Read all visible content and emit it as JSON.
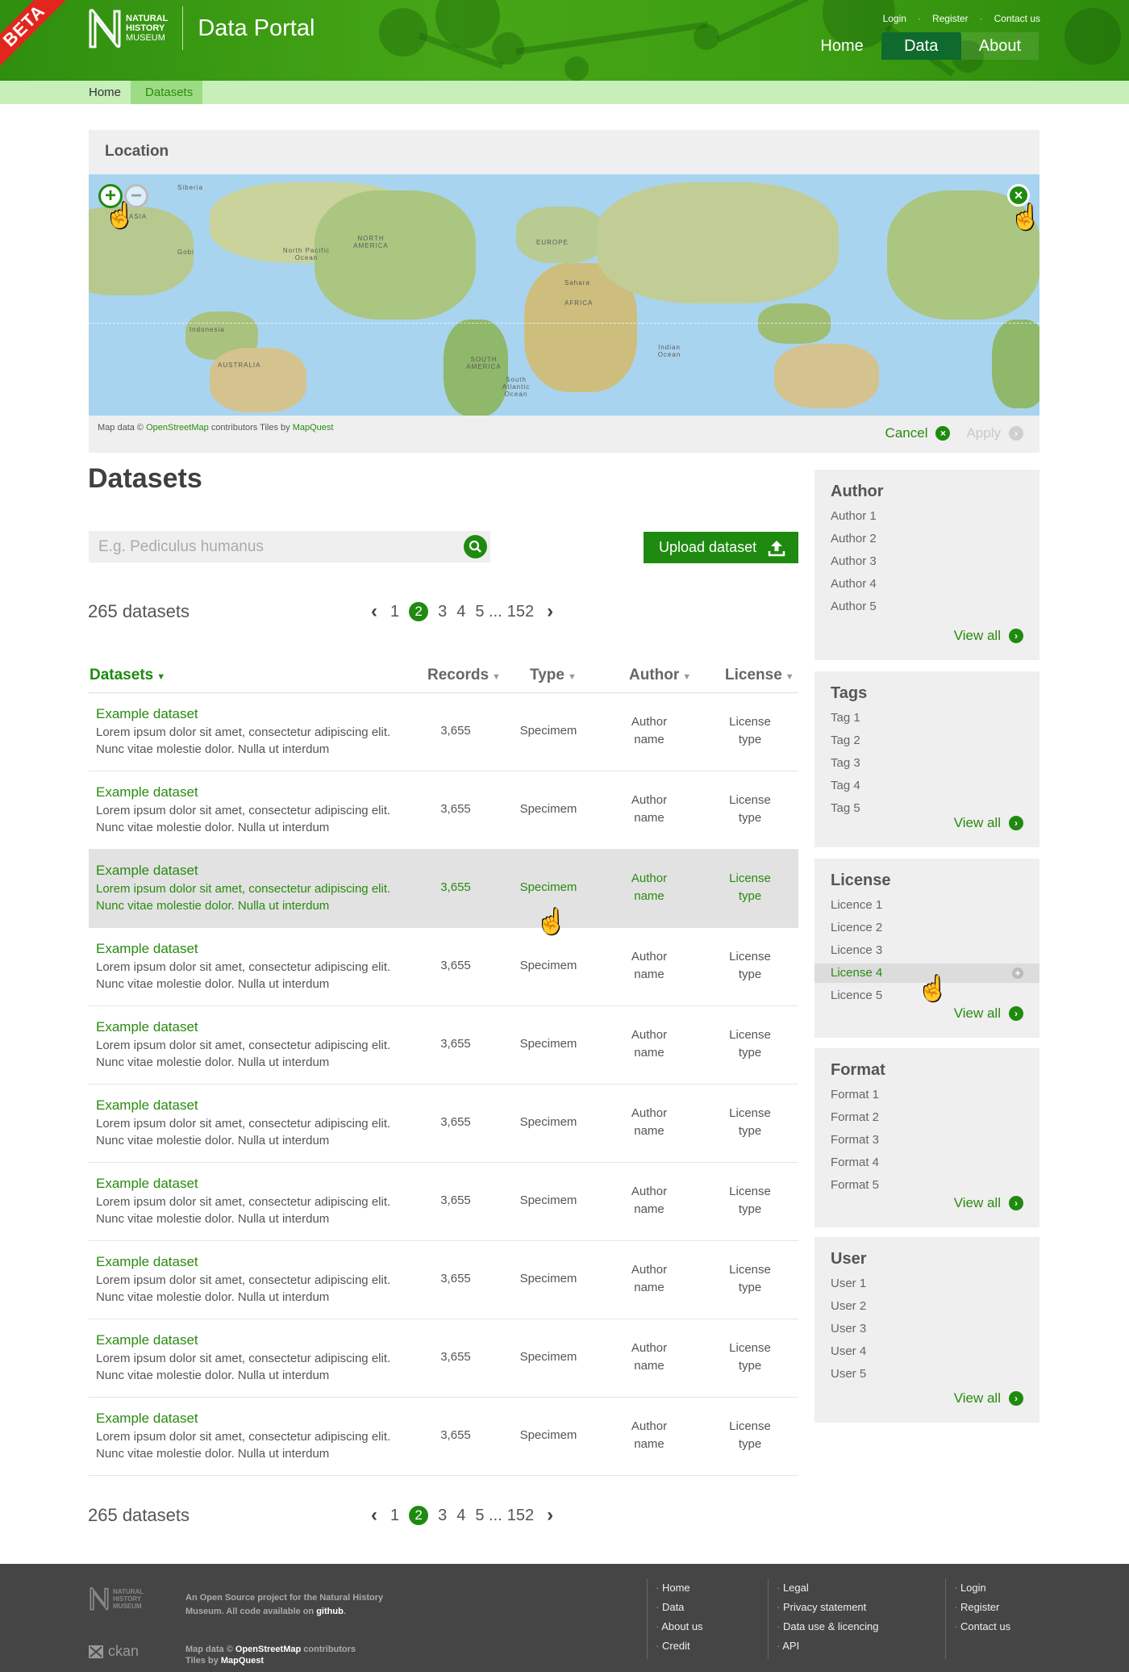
{
  "header": {
    "beta": "BETA",
    "logo_lines": [
      "NATURAL",
      "HISTORY",
      "MUSEUM"
    ],
    "portal_title": "Data Portal",
    "top_links": [
      "Login",
      "Register",
      "Contact us"
    ],
    "nav": [
      "Home",
      "Data",
      "About"
    ],
    "active_nav": "Data"
  },
  "breadcrumb": {
    "home": "Home",
    "current": "Datasets"
  },
  "location": {
    "title": "Location",
    "map_labels": [
      "Siberia",
      "ASIA",
      "NORTH AMERICA",
      "EUROPE",
      "AFRICA",
      "SOUTH AMERICA",
      "AUSTRALIA",
      "Indonesia",
      "North Pacific Ocean",
      "South Atlantic Ocean",
      "Indian Ocean",
      "Sahara",
      "Gobi"
    ],
    "attribution_prefix": "Map data ©",
    "attribution_osm": "OpenStreetMap",
    "attribution_mid": "contributors Tiles by",
    "attribution_mq": "MapQuest",
    "cancel": "Cancel",
    "apply": "Apply"
  },
  "main": {
    "title": "Datasets",
    "search_placeholder": "E.g. Pediculus humanus",
    "upload_label": "Upload dataset",
    "count": "265 datasets",
    "pager": [
      "1",
      "2",
      "3",
      "4",
      "5 ...",
      "152"
    ],
    "current_page": "2",
    "columns": [
      "Datasets",
      "Records",
      "Type",
      "Author",
      "License"
    ],
    "rows": [
      {
        "name": "Example dataset",
        "desc": "Lorem ipsum dolor sit amet, consectetur adipiscing elit. Nunc vitae molestie dolor. Nulla ut interdum",
        "records": "3,655",
        "type": "Specimem",
        "author": "Author name",
        "license": "License type"
      },
      {
        "name": "Example dataset",
        "desc": "Lorem ipsum dolor sit amet, consectetur adipiscing elit. Nunc vitae molestie dolor. Nulla ut interdum",
        "records": "3,655",
        "type": "Specimem",
        "author": "Author name",
        "license": "License type"
      },
      {
        "name": "Example dataset",
        "desc": "Lorem ipsum dolor sit amet, consectetur adipiscing elit. Nunc vitae molestie dolor. Nulla ut interdum",
        "records": "3,655",
        "type": "Specimem",
        "author": "Author name",
        "license": "License type"
      },
      {
        "name": "Example dataset",
        "desc": "Lorem ipsum dolor sit amet, consectetur adipiscing elit. Nunc vitae molestie dolor. Nulla ut interdum",
        "records": "3,655",
        "type": "Specimem",
        "author": "Author name",
        "license": "License type"
      },
      {
        "name": "Example dataset",
        "desc": "Lorem ipsum dolor sit amet, consectetur adipiscing elit. Nunc vitae molestie dolor. Nulla ut interdum",
        "records": "3,655",
        "type": "Specimem",
        "author": "Author name",
        "license": "License type"
      },
      {
        "name": "Example dataset",
        "desc": "Lorem ipsum dolor sit amet, consectetur adipiscing elit. Nunc vitae molestie dolor. Nulla ut interdum",
        "records": "3,655",
        "type": "Specimem",
        "author": "Author name",
        "license": "License type"
      },
      {
        "name": "Example dataset",
        "desc": "Lorem ipsum dolor sit amet, consectetur adipiscing elit. Nunc vitae molestie dolor. Nulla ut interdum",
        "records": "3,655",
        "type": "Specimem",
        "author": "Author name",
        "license": "License type"
      },
      {
        "name": "Example dataset",
        "desc": "Lorem ipsum dolor sit amet, consectetur adipiscing elit. Nunc vitae molestie dolor. Nulla ut interdum",
        "records": "3,655",
        "type": "Specimem",
        "author": "Author name",
        "license": "License type"
      },
      {
        "name": "Example dataset",
        "desc": "Lorem ipsum dolor sit amet, consectetur adipiscing elit. Nunc vitae molestie dolor. Nulla ut interdum",
        "records": "3,655",
        "type": "Specimem",
        "author": "Author name",
        "license": "License type"
      },
      {
        "name": "Example dataset",
        "desc": "Lorem ipsum dolor sit amet, consectetur adipiscing elit. Nunc vitae molestie dolor. Nulla ut interdum",
        "records": "3,655",
        "type": "Specimem",
        "author": "Author name",
        "license": "License type"
      }
    ],
    "highlighted_row": 2
  },
  "sidebar": {
    "view_all": "View all",
    "facets": [
      {
        "title": "Author",
        "items": [
          "Author 1",
          "Author 2",
          "Author 3",
          "Author 4",
          "Author 5"
        ]
      },
      {
        "title": "Tags",
        "items": [
          "Tag 1",
          "Tag 2",
          "Tag 3",
          "Tag 4",
          "Tag 5"
        ]
      },
      {
        "title": "License",
        "items": [
          "Licence 1",
          "Licence 2",
          "Licence 3",
          "License 4",
          "Licence 5"
        ],
        "highlighted": 3
      },
      {
        "title": "Format",
        "items": [
          "Format 1",
          "Format 2",
          "Format 3",
          "Format 4",
          "Format 5"
        ]
      },
      {
        "title": "User",
        "items": [
          "User 1",
          "User 2",
          "User 3",
          "User 4",
          "User 5"
        ]
      }
    ]
  },
  "footer": {
    "logo_lines": [
      "NATURAL",
      "HISTORY",
      "MUSEUM"
    ],
    "about_line1": "An Open Source project for the Natural History",
    "about_line2_prefix": "Museum.  All code available on",
    "about_github": "github",
    "map_prefix": "Map data ©",
    "map_osm": "OpenStreetMap",
    "map_mid": "contributors",
    "tiles_prefix": "Tiles by",
    "tiles_mq": "MapQuest",
    "ckan": "ckan",
    "col1": [
      "Home",
      "Data",
      "About us",
      "Credit"
    ],
    "col2": [
      "Legal",
      "Privacy statement",
      "Data use & licencing",
      "API"
    ],
    "col3": [
      "Login",
      "Register",
      "Contact us"
    ]
  },
  "colors": {
    "brand_green": "#1f8a10",
    "header_green": "#3e9e12",
    "breadcrumb_bg": "#c6efb9",
    "beta_red": "#e3261d",
    "footer_bg": "#454545"
  }
}
